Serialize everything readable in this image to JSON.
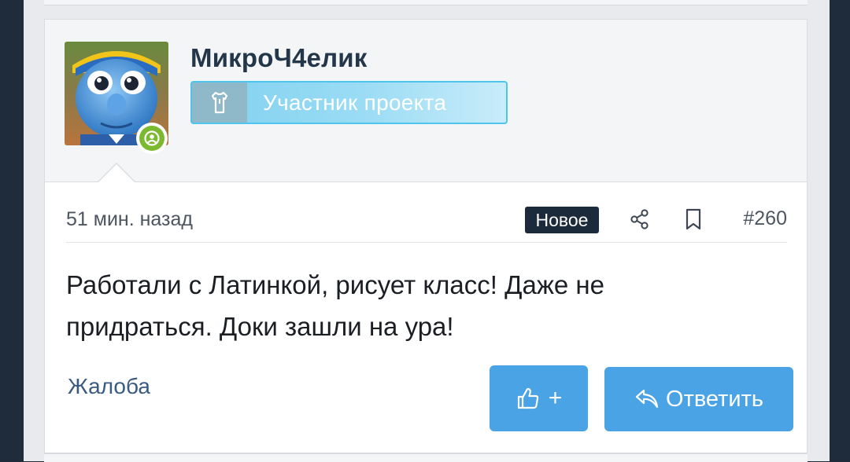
{
  "post": {
    "author": {
      "username": "МикроЧ4елик",
      "title": "Участник проекта",
      "avatar_icon": "robot-avatar-image",
      "title_icon": "shirt-icon",
      "online_icon": "user-online-icon"
    },
    "time_ago": "51 мин. назад",
    "new_badge": "Новое",
    "number": "#260",
    "body_line1": "Работали с Латинкой, рисует класс! Даже не",
    "body_line2": "придраться. Доки зашли на ура!",
    "report_label": "Жалоба",
    "like_plus": "+",
    "reply_label": "Ответить"
  },
  "colors": {
    "accent_blue": "#4aa3e4",
    "badge_dark": "#1c2b3c",
    "online_green": "#7bb931",
    "title_blue": "#7fd0ef",
    "username_color": "#23364a"
  },
  "icons": [
    "share-icon",
    "bookmark-icon",
    "thumbs-up-icon",
    "reply-arrow-icon"
  ]
}
